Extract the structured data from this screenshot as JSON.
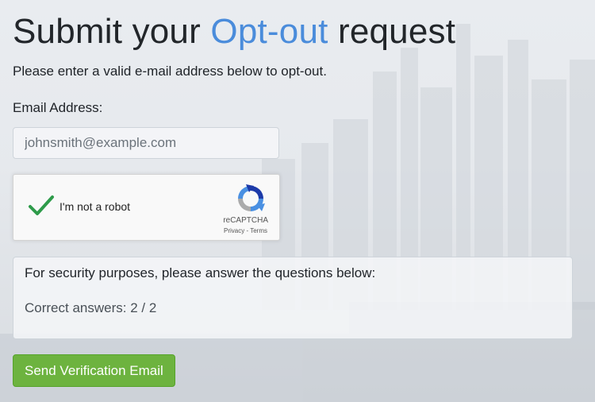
{
  "heading": {
    "prefix": "Submit your",
    "accent": "Opt-out",
    "suffix": "request"
  },
  "subtitle": "Please enter a valid e-mail address below to opt-out.",
  "email": {
    "label": "Email Address:",
    "placeholder": "johnsmith@example.com",
    "value": ""
  },
  "captcha": {
    "checked": true,
    "label": "I'm not a robot",
    "brand": "reCAPTCHA",
    "privacy": "Privacy",
    "separator": " - ",
    "terms": "Terms"
  },
  "security": {
    "question": "For security purposes, please answer the questions below:",
    "score": "Correct answers: 2 / 2"
  },
  "submit": {
    "label": "Send Verification Email"
  },
  "colors": {
    "accent": "#4a8cdb",
    "button": "#6db33f",
    "check": "#2e9b4a"
  },
  "icons": {
    "check": "check-icon",
    "recaptcha": "recaptcha-logo-icon"
  }
}
